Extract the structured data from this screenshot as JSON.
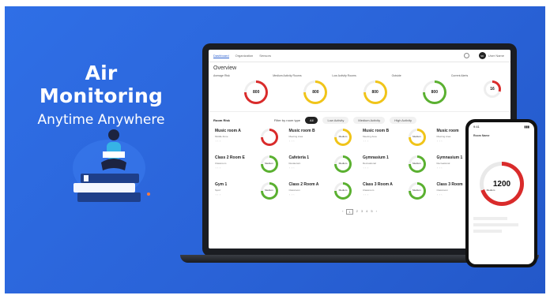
{
  "banner": {
    "headline": "Air Monitoring",
    "subheadline": "Anytime Anywhere",
    "colors": {
      "background": "#2a63d8",
      "text": "#ffffff"
    }
  },
  "laptop": {
    "nav": {
      "tabs": [
        "Dashboard",
        "Organization",
        "Sensors"
      ],
      "active_tab": "Dashboard",
      "user_initials": "SD",
      "user_name": "User Name"
    },
    "overview_title": "Overview",
    "gauges": [
      {
        "label": "Average Risk",
        "value": "800",
        "color": "#d92b2b"
      },
      {
        "label": "Medium Activity Rooms",
        "value": "800",
        "color": "#f0c419"
      },
      {
        "label": "Low Activity Rooms",
        "value": "800",
        "color": "#f0c419"
      },
      {
        "label": "Outside",
        "value": "800",
        "color": "#5ab030"
      },
      {
        "label": "Current Alerts",
        "value": "16",
        "color": "#d92b2b"
      }
    ],
    "rooms_title": "Room Risk",
    "filters": {
      "label": "Filter by room type",
      "options": [
        "All",
        "Low Activity",
        "Medium Activity",
        "High Activity"
      ],
      "selected": "All"
    },
    "rooms": [
      {
        "name": "Music room A",
        "sub": "Middle Zone",
        "state": "",
        "color": "#d92b2b"
      },
      {
        "name": "Music room B",
        "sub": "Meeting Area",
        "state": "Medium",
        "color": "#f0c419"
      },
      {
        "name": "Music room B",
        "sub": "Meeting Area",
        "state": "Medium",
        "color": "#f0c419"
      },
      {
        "name": "Music room",
        "sub": "Meeting Area",
        "state": "",
        "color": "#d92b2b"
      },
      {
        "name": "Class 2 Room E",
        "sub": "Classroom",
        "state": "Medium",
        "color": "#5ab030"
      },
      {
        "name": "Cafeteria 1",
        "sub": "Restaurant",
        "state": "Medium",
        "color": "#5ab030"
      },
      {
        "name": "Gymnasium 1",
        "sub": "Recreational",
        "state": "Medium",
        "color": "#5ab030"
      },
      {
        "name": "Gymnasium 1",
        "sub": "Recreational",
        "state": "",
        "color": "#5ab030"
      },
      {
        "name": "Gym 1",
        "sub": "Sport",
        "state": "Medium",
        "color": "#5ab030"
      },
      {
        "name": "Class 2 Room A",
        "sub": "Classroom",
        "state": "Medium",
        "color": "#5ab030"
      },
      {
        "name": "Class 3 Room A",
        "sub": "Classroom",
        "state": "Medium",
        "color": "#5ab030"
      },
      {
        "name": "Class 3 Room",
        "sub": "Classroom",
        "state": "Medium",
        "color": "#5ab030"
      }
    ],
    "pager": [
      "1",
      "2",
      "3",
      "4",
      "5"
    ]
  },
  "phone": {
    "time": "9:41",
    "room_name": "Room Name",
    "big_value": "1200",
    "ring_color": "#d92b2b"
  }
}
